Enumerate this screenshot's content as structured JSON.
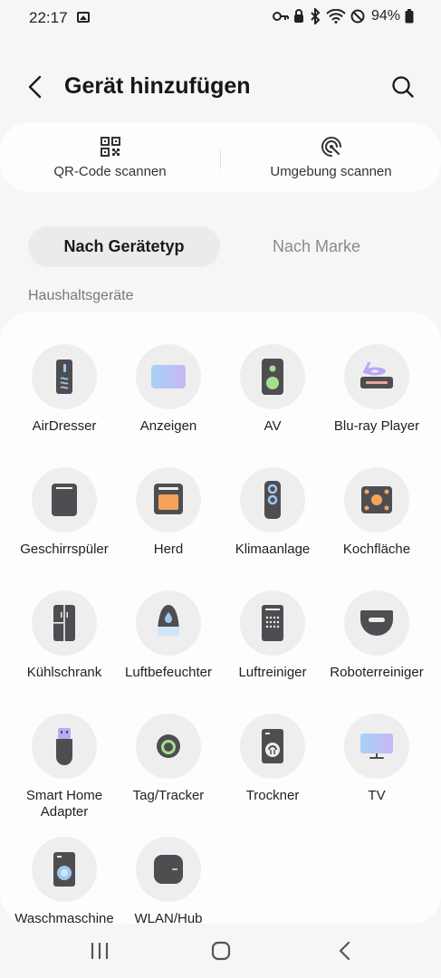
{
  "status": {
    "time": "22:17",
    "battery": "94%"
  },
  "header": {
    "title": "Gerät hinzufügen"
  },
  "scan": {
    "qr_label": "QR-Code scannen",
    "nearby_label": "Umgebung scannen"
  },
  "tabs": [
    {
      "label": "Nach Gerätetyp",
      "active": true
    },
    {
      "label": "Nach Marke",
      "active": false
    }
  ],
  "section": {
    "title": "Haushaltsgeräte"
  },
  "devices": [
    {
      "label": "AirDresser",
      "icon": "airdresser-icon"
    },
    {
      "label": "Anzeigen",
      "icon": "display-icon"
    },
    {
      "label": "AV",
      "icon": "speaker-icon"
    },
    {
      "label": "Blu-ray Player",
      "icon": "bluray-icon"
    },
    {
      "label": "Geschirrspüler",
      "icon": "dishwasher-icon"
    },
    {
      "label": "Herd",
      "icon": "oven-icon"
    },
    {
      "label": "Klimaanlage",
      "icon": "air-conditioner-icon"
    },
    {
      "label": "Kochfläche",
      "icon": "cooktop-icon"
    },
    {
      "label": "Kühlschrank",
      "icon": "fridge-icon"
    },
    {
      "label": "Luftbefeuchter",
      "icon": "humidifier-icon"
    },
    {
      "label": "Luftreiniger",
      "icon": "air-purifier-icon"
    },
    {
      "label": "Roboterreiniger",
      "icon": "robot-vacuum-icon"
    },
    {
      "label": "Smart Home Adapter",
      "icon": "smart-home-adapter-icon"
    },
    {
      "label": "Tag/Tracker",
      "icon": "tracker-icon"
    },
    {
      "label": "Trockner",
      "icon": "dryer-icon"
    },
    {
      "label": "TV",
      "icon": "tv-icon"
    },
    {
      "label": "Waschmaschine",
      "icon": "washer-icon"
    },
    {
      "label": "WLAN/Hub",
      "icon": "wifi-hub-icon"
    }
  ],
  "colors": {
    "accent_purple": "#b9a8f5",
    "accent_blue": "#9fc8ef",
    "accent_orange": "#f6a35a",
    "accent_green": "#a6df8c",
    "icon_dark": "#4e4e52"
  }
}
